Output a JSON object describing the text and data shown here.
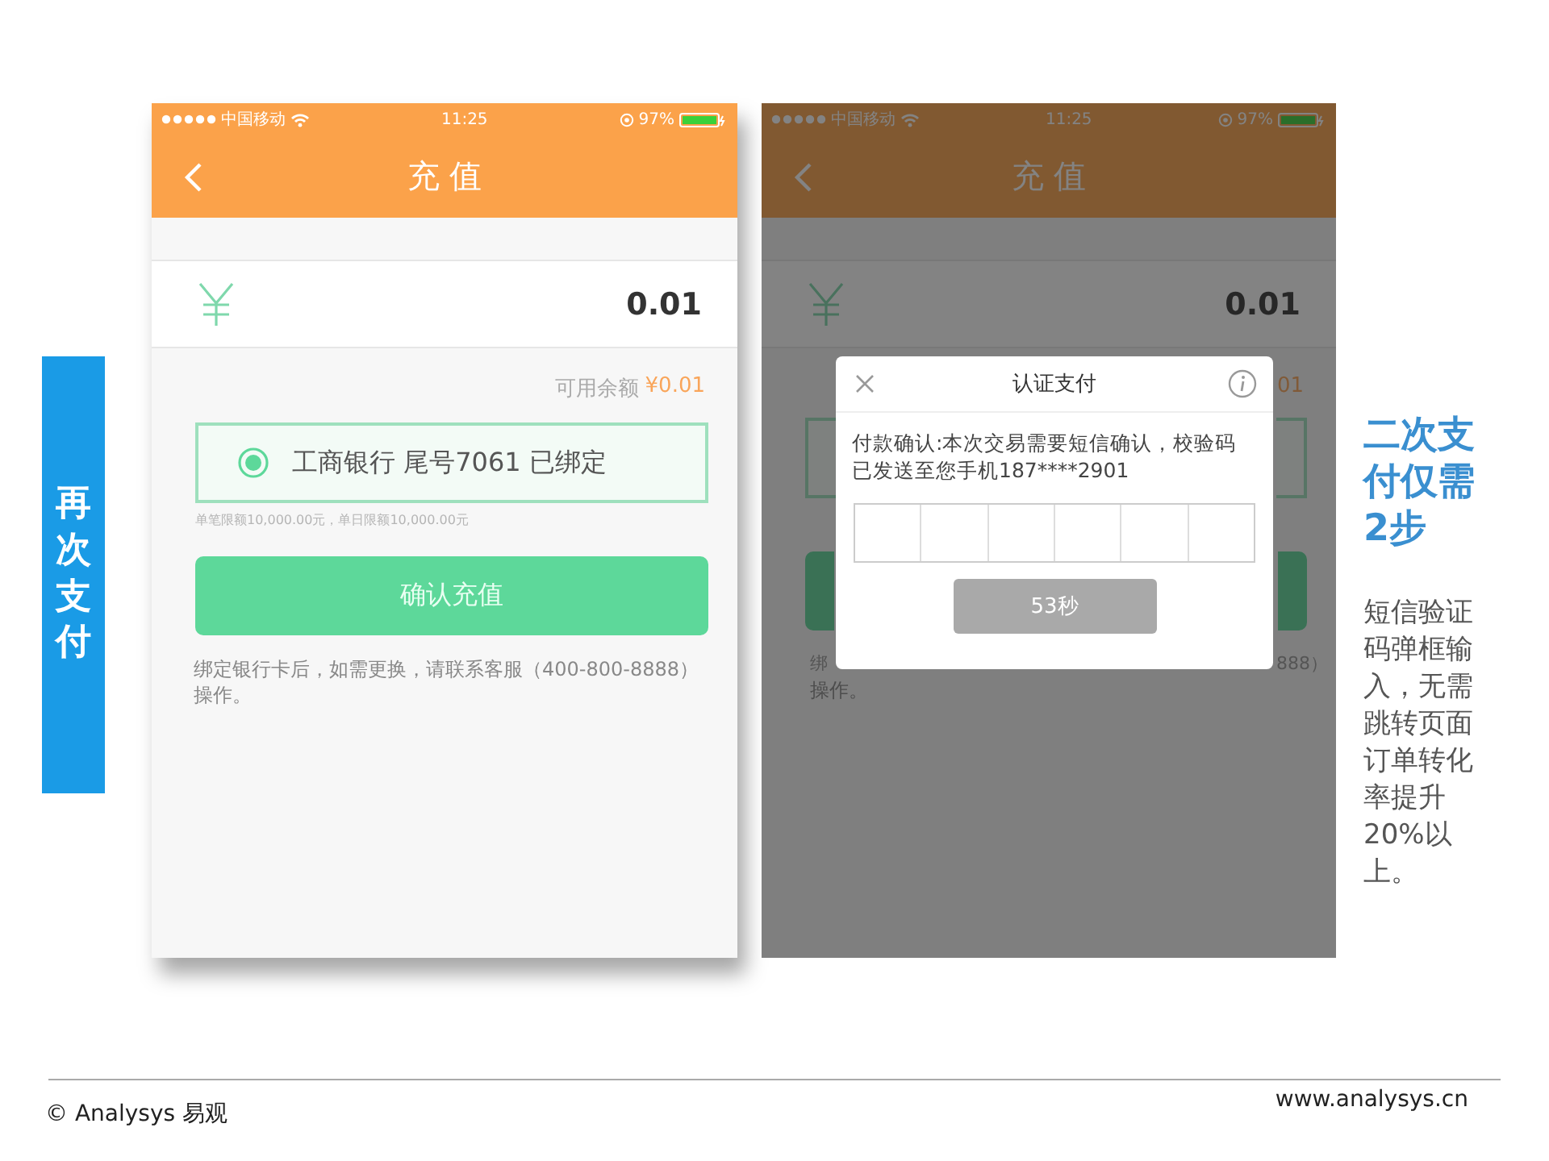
{
  "side_label": "再次支付",
  "first_screen": {
    "status_bar": {
      "carrier": "中国移动",
      "time": "11:25",
      "battery": "97%"
    },
    "title": "充 值",
    "amount": "0.01",
    "balance_label": "可用余额",
    "balance": "¥0.01",
    "bank": {
      "label": "工商银行 尾号7061 已绑定",
      "selected": true
    },
    "limits": "单笔限额10,000.00元，单日限额10,000.00元",
    "confirm_button": "确认充值",
    "note": "绑定银行卡后，如需更换，请联系客服（400-800-8888）操作。"
  },
  "second_screen": {
    "status_bar": {
      "carrier": "中国移动",
      "time": "11:25",
      "battery": "97%"
    },
    "title": "充 值",
    "amount": "0.01",
    "balance_fragment": "01",
    "note_left_fragment": "绑",
    "note_right_fragment": "888）",
    "note_second_line": "操作。",
    "dialog": {
      "title": "认证支付",
      "message": "付款确认:本次交易需要短信确认，校验码已发送至您手机187****2901",
      "countdown_button": {
        "label": "53秒",
        "disabled": true
      }
    }
  },
  "heading": "二次支付仅需2步",
  "description": "短信验证码弹框输入，无需跳转页面订单转化率提升20%以上。",
  "footer": {
    "copyright": "© Analysys 易观",
    "website": "www.analysys.cn"
  }
}
